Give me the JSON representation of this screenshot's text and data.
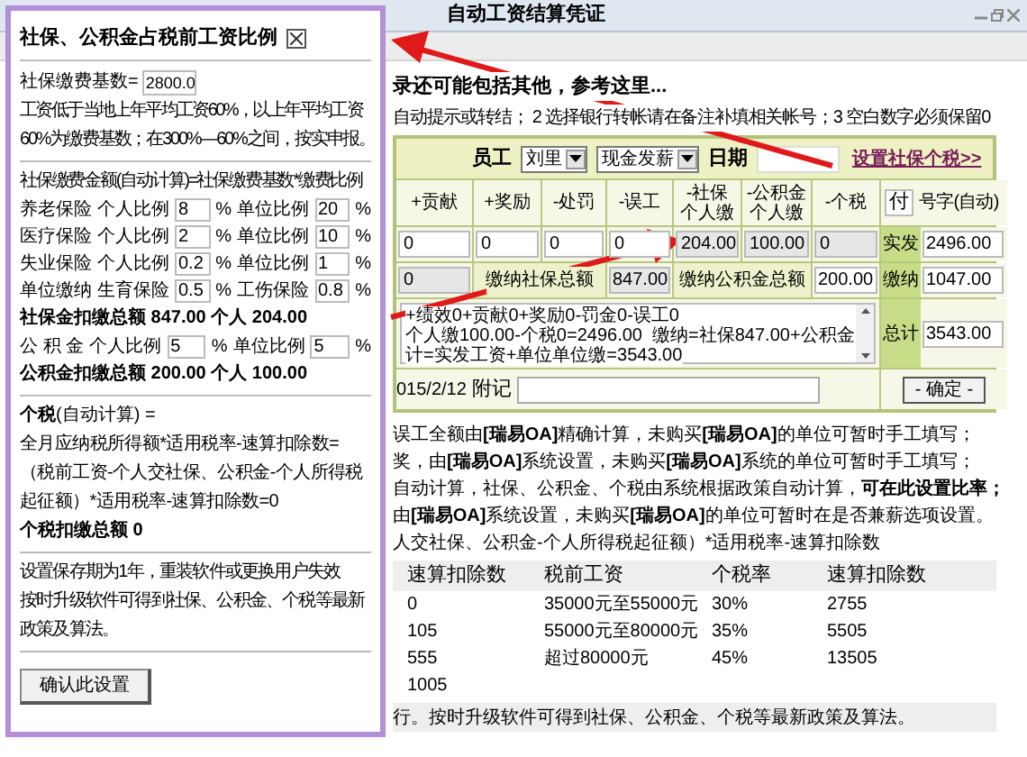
{
  "window": {
    "title": "自动工资结算凭证"
  },
  "intro": "录还可能包括其他，参考这里...",
  "hints": "自动提示或转结； 2 选择银行转帐请在备注补填相关帐号；3 空白数字必须保留0",
  "form": {
    "employee_label": "员工",
    "employee": "刘里",
    "pay_method": "现金发薪",
    "date_label": "日期",
    "settings_link": "设置社保个税>>",
    "columns": [
      "+贡献",
      "+奖励",
      "-处罚",
      "-误工",
      "-社保个人缴",
      "-公积金个人缴",
      "-个税"
    ],
    "voucher_prefix": "付",
    "voucher_label": "号字(自动)",
    "amounts": [
      {
        "value": "0",
        "readonly": false
      },
      {
        "value": "0",
        "readonly": false
      },
      {
        "value": "0",
        "readonly": false
      },
      {
        "value": "0",
        "readonly": false
      },
      {
        "value": "204.00",
        "readonly": true
      },
      {
        "value": "100.00",
        "readonly": true
      },
      {
        "value": "0",
        "readonly": true
      }
    ],
    "net_label": "实发",
    "net_value": "2496.00",
    "other_value": "0",
    "social_total_label": "缴纳社保总额",
    "social_total": "847.00",
    "fund_total_label": "缴纳公积金总额",
    "fund_total": "200.00",
    "paid_label": "缴纳",
    "paid_value": "1047.00",
    "calc_lines": [
      "+绩效0+贡献0+奖励0-罚金0-误工0",
      "个人缴100.00-个税0=2496.00  缴纳=社保847.00+公积金",
      "计=实发工资+单位单位缴=3543.00"
    ],
    "grand_label": "总计",
    "grand_value": "3543.00",
    "date_fragment": "015/2/12",
    "remark_label": "附记",
    "confirm_button": "- 确定 -"
  },
  "notes": [
    "误工全额由**[瑞易OA]**精确计算，未购买**[瑞易OA]**的单位可暂时手工填写；",
    "奖，由**[瑞易OA]**系统设置，未购买**[瑞易OA]**系统的单位可暂时手工填写；",
    "自动计算，社保、公积金、个税由系统根据政策自动计算，**可在此设置比率；**",
    "由**[瑞易OA]**系统设置，未购买**[瑞易OA]**的单位可暂时在是否兼薪选项设置。",
    "人交社保、公积金-个人所得税起征额）*适用税率-速算扣除数"
  ],
  "tax_table": {
    "columns": [
      "速算扣除数",
      "税前工资",
      "个税率",
      "速算扣除数"
    ],
    "rows": [
      [
        "0",
        "35000元至55000元",
        "30%",
        "2755"
      ],
      [
        "105",
        "55000元至80000元",
        "35%",
        "5505"
      ],
      [
        "555",
        "超过80000元",
        "45%",
        "13505"
      ],
      [
        "1005"
      ]
    ]
  },
  "footer": "行。按时升级软件可得到社保、公积金、个税等最新政策及算法。",
  "settings_panel": {
    "title": "社保、公积金占税前工资比例",
    "base": {
      "label": "社保缴费基数=",
      "value": "2800.0"
    },
    "base_notes": [
      "工资低于当地上年平均工资60%，以上年平均工资",
      "60%为缴费基数；在300%—60%之间，按实申报。"
    ],
    "formula": "社保缴费金额(自动计算)=社保缴费基数*缴费比例",
    "social_rates": [
      {
        "name": "养老保险",
        "first_label": "个人比例",
        "first_value": "8",
        "first_unit": "%",
        "second_label": "单位比例",
        "second_value": "20",
        "second_unit": "%"
      },
      {
        "name": "医疗保险",
        "first_label": "个人比例",
        "first_value": "2",
        "first_unit": "%",
        "second_label": "单位比例",
        "second_value": "10",
        "second_unit": "%"
      },
      {
        "name": "失业保险",
        "first_label": "个人比例",
        "first_value": "0.2",
        "first_unit": "%",
        "second_label": "单位比例",
        "second_value": "1",
        "second_unit": "%"
      },
      {
        "name": "单位缴纳",
        "first_label": "生育保险",
        "first_value": "0.5",
        "first_unit": "%",
        "second_label": "工伤保险",
        "second_value": "0.8",
        "second_unit": "%"
      }
    ],
    "social_total": "社保金扣缴总额 847.00 个人 204.00",
    "fund_rate": {
      "name": "公 积 金",
      "first_label": "个人比例",
      "first_value": "5",
      "first_unit": "%",
      "second_label": "单位比例",
      "second_value": "5",
      "second_unit": "%"
    },
    "fund_total": "公积金扣缴总额 200.00 个人 100.00",
    "tax_heading": "**个税**(自动计算) =",
    "tax_formula": [
      "全月应纳税所得额*适用税率-速算扣除数=",
      "（税前工资-个人交社保、公积金-个人所得税起征额）*适用税率-速算扣除数=0"
    ],
    "tax_total": "个税扣缴总额 0",
    "notes": [
      "设置保存期为1年，重装软件或更换用户失效",
      "按时升级软件可得到社保、公积金、个税等最新政策及算法。"
    ],
    "confirm_button": "确认此设置"
  }
}
